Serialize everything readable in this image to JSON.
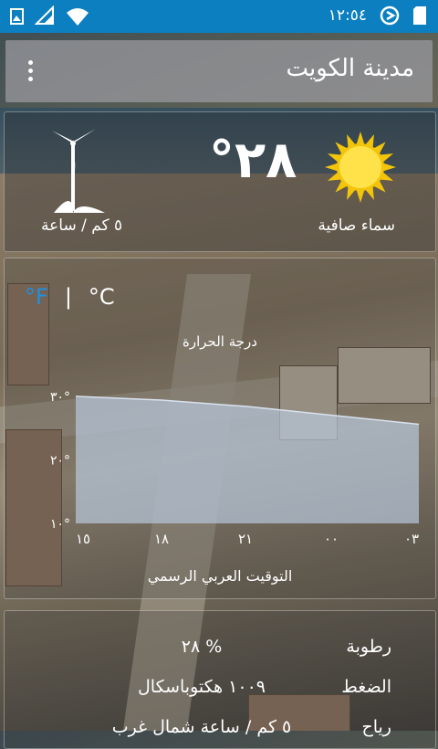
{
  "status_bar": {
    "clock": "١٢:٥٤"
  },
  "app_bar": {
    "title": "مدينة الكويت"
  },
  "current": {
    "condition": "سماء صافية",
    "temperature": "°٢٨",
    "wind": "٥ كم / ساعة",
    "condition_icon": "sun-icon",
    "wind_icon": "wind-turbine-icon"
  },
  "chart_toggle": {
    "fahrenheit": "°F",
    "separator": "|",
    "celsius": "°C",
    "selected": "°F"
  },
  "chart_data": {
    "type": "area",
    "title": "درجة الحرارة",
    "xlabel": "التوقيت العربي الرسمي",
    "ylabel": "",
    "x": [
      "١٥",
      "١٨",
      "٢١",
      "٠٠",
      "٠٣"
    ],
    "series": [
      {
        "values": [
          30,
          29.4,
          28.4,
          27,
          25.6
        ]
      }
    ],
    "yticks": [
      "١٠°",
      "٢٠°",
      "٣٠°"
    ],
    "ylim": [
      10,
      33
    ],
    "grid": false,
    "fill_color": "#b8c8dc"
  },
  "details": {
    "humidity_label": "رطوبة",
    "humidity_value": "٢٨ %",
    "pressure_label": "الضغط",
    "pressure_value": "١٠٠٩ هكتوباسكال",
    "wind_label": "رياح",
    "wind_value": "٥ كم / ساعة شمال غرب"
  },
  "colors": {
    "status_bar": "#0b7fc0",
    "accent": "#1e90e0"
  }
}
